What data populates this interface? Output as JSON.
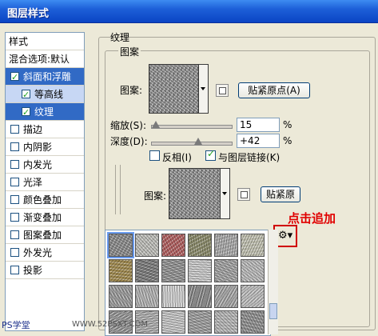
{
  "window": {
    "title": "图层样式"
  },
  "sidebar": {
    "header": "样式",
    "blend_options": "混合选项:默认",
    "items": [
      {
        "label": "斜面和浮雕",
        "checked": true
      },
      {
        "label": "等高线",
        "checked": true
      },
      {
        "label": "纹理",
        "checked": true
      },
      {
        "label": "描边",
        "checked": false
      },
      {
        "label": "内阴影",
        "checked": false
      },
      {
        "label": "内发光",
        "checked": false
      },
      {
        "label": "光泽",
        "checked": false
      },
      {
        "label": "颜色叠加",
        "checked": false
      },
      {
        "label": "渐变叠加",
        "checked": false
      },
      {
        "label": "图案叠加",
        "checked": false
      },
      {
        "label": "外发光",
        "checked": false
      },
      {
        "label": "投影",
        "checked": false
      }
    ]
  },
  "panel": {
    "title": "纹理",
    "group_label": "图案",
    "pattern_label": "图案:",
    "snap_button": "贴紧原点(A)",
    "scale_label": "缩放(S):",
    "scale_value": "15",
    "scale_unit": "%",
    "depth_label": "深度(D):",
    "depth_value": "+42",
    "depth_unit": "%",
    "invert_label": "反相(I)",
    "invert_checked": false,
    "link_label": "与图层链接(K)",
    "link_checked": true,
    "pattern_label_2": "图案:",
    "snap_button_2": "贴紧原"
  },
  "annotation": {
    "text": "点击追加",
    "color": "#e00000"
  },
  "gear": {
    "icon": "gear-icon"
  },
  "watermark": {
    "text": "PS学堂",
    "text2": "WWW.52PSXT.COM"
  },
  "picker": {
    "tiles": [
      "#8a8a8a",
      "#bdbdb8",
      "#b06060",
      "#8a8a6a",
      "#a8a8a8",
      "#c0c0b0",
      "#a08a50",
      "#7a7a7a",
      "#909090",
      "#c8c8c8",
      "#a0a0a0",
      "#b8b8b8",
      "#9a9a9a",
      "#b0b0b0",
      "#cfcfcf",
      "#888888",
      "#a5a5a5",
      "#bcbcbc",
      "#959595",
      "#acacac",
      "#c4c4c4",
      "#9c9c9c",
      "#b4b4b4",
      "#8e8e8e"
    ]
  }
}
